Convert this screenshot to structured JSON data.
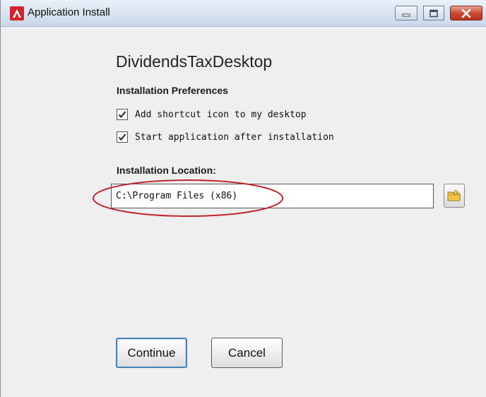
{
  "window": {
    "title": "Application Install",
    "icons": {
      "app": "adobe-air-icon",
      "minimize": "minimize-icon",
      "maximize": "maximize-icon",
      "close": "close-icon",
      "browse": "folder-icon"
    },
    "colors": {
      "app_icon": "#d2232a",
      "close_button": "#c9452d",
      "highlight_ellipse": "#c0262d",
      "focus_border": "#4b7fb6"
    }
  },
  "installer": {
    "app_name": "DividendsTaxDesktop",
    "preferences_heading": "Installation Preferences",
    "options": [
      {
        "label": "Add shortcut icon to my desktop",
        "checked": true
      },
      {
        "label": "Start application after installation",
        "checked": true
      }
    ],
    "location_heading": "Installation Location:",
    "location_value": "C:\\Program Files (x86)",
    "continue_label": "Continue",
    "cancel_label": "Cancel"
  }
}
